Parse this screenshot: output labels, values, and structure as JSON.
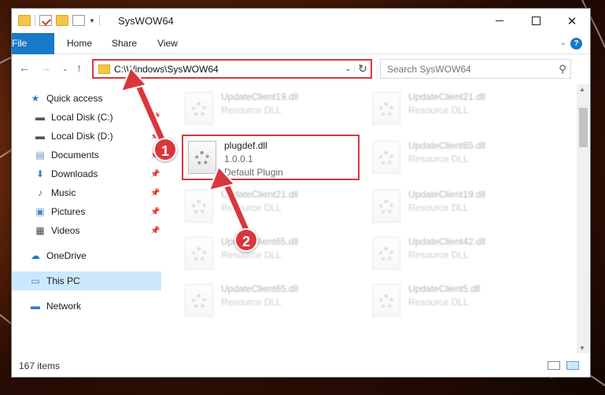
{
  "window": {
    "title": "SysWOW64"
  },
  "ribbon": {
    "tabs": [
      "File",
      "Home",
      "Share",
      "View"
    ]
  },
  "address": {
    "path": "C:\\Windows\\SysWOW64"
  },
  "search": {
    "placeholder": "Search SysWOW64"
  },
  "sidebar": {
    "items": [
      {
        "label": "Quick access",
        "icon": "star-icon"
      },
      {
        "label": "Local Disk (C:)",
        "icon": "drive-icon"
      },
      {
        "label": "Local Disk (D:)",
        "icon": "drive-icon"
      },
      {
        "label": "Documents",
        "icon": "documents-icon"
      },
      {
        "label": "Downloads",
        "icon": "download-icon"
      },
      {
        "label": "Music",
        "icon": "music-icon"
      },
      {
        "label": "Pictures",
        "icon": "pictures-icon"
      },
      {
        "label": "Videos",
        "icon": "videos-icon"
      },
      {
        "label": "OneDrive",
        "icon": "cloud-icon"
      },
      {
        "label": "This PC",
        "icon": "computer-icon"
      },
      {
        "label": "Network",
        "icon": "network-icon"
      }
    ]
  },
  "files": {
    "highlighted": {
      "name": "plugdef.dll",
      "version": "1.0.0.1",
      "description": "Default Plugin"
    },
    "items": [
      {
        "name": "UpdateClient19.dll",
        "description": "Resource DLL"
      },
      {
        "name": "UpdateClient21.dll",
        "description": "Resource DLL"
      },
      {
        "name": "UpdateClient65.dll",
        "description": "Resource DLL"
      },
      {
        "name": "UpdateClient21.dll",
        "description": "Resource DLL"
      },
      {
        "name": "UpdateClient19.dll",
        "description": "Resource DLL"
      },
      {
        "name": "UpdateClient65.dll",
        "description": "Resource DLL"
      },
      {
        "name": "UpdateClient42.dll",
        "description": "Resource DLL"
      },
      {
        "name": "UpdateClient65.dll",
        "description": "Resource DLL"
      },
      {
        "name": "UpdateClient5.dll",
        "description": "Resource DLL"
      }
    ]
  },
  "status": {
    "count": "167 items"
  },
  "annotations": {
    "badge1": "1",
    "badge2": "2"
  },
  "colors": {
    "accent": "#1979ca",
    "highlight": "#d9363e",
    "selected": "#cce8ff"
  }
}
